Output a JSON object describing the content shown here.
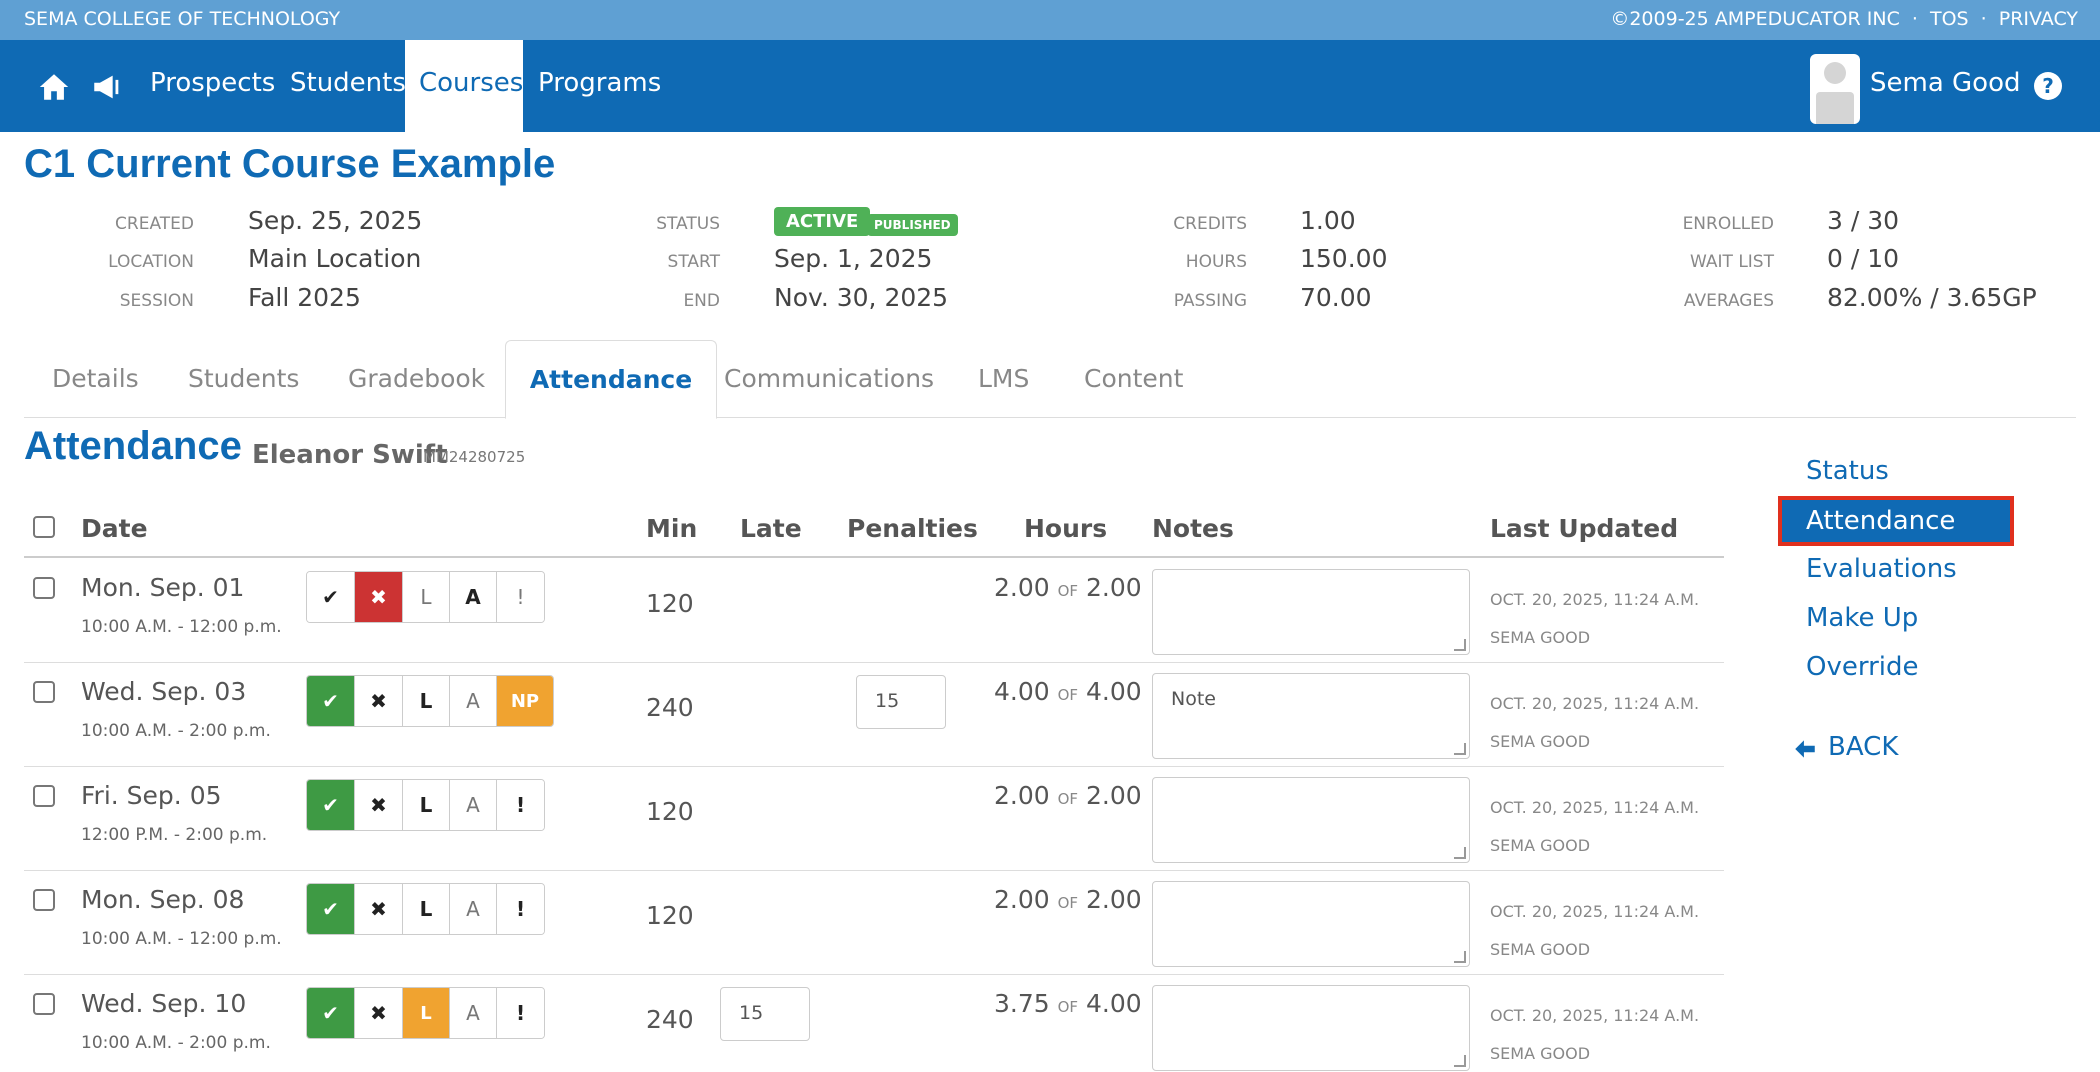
{
  "topstrip": {
    "college": "SEMA COLLEGE OF TECHNOLOGY",
    "copyright": "©2009-25 AMPEDUCATOR INC",
    "sep": "·",
    "tos": "TOS",
    "privacy": "PRIVACY"
  },
  "nav": {
    "icons": [
      "home-icon",
      "megaphone-icon"
    ],
    "items": [
      "Prospects",
      "Students",
      "Courses",
      "Programs"
    ],
    "active": "Courses",
    "user": "Sema Good",
    "help": "?"
  },
  "course": {
    "title": "C1 Current Course Example",
    "created_label": "CREATED",
    "created": "Sep. 25, 2025",
    "location_label": "LOCATION",
    "location": "Main Location",
    "session_label": "SESSION",
    "session": "Fall 2025",
    "status_label": "STATUS",
    "status": "ACTIVE",
    "published": "PUBLISHED",
    "start_label": "START",
    "start": "Sep. 1, 2025",
    "end_label": "END",
    "end": "Nov. 30, 2025",
    "credits_label": "CREDITS",
    "credits": "1.00",
    "hours_label": "HOURS",
    "hours": "150.00",
    "passing_label": "PASSING",
    "passing": "70.00",
    "enrolled_label": "ENROLLED",
    "enrolled": "3 / 30",
    "waitlist_label": "WAIT LIST",
    "waitlist": "0 / 10",
    "averages_label": "AVERAGES",
    "averages": "82.00% / 3.65GP"
  },
  "tabs": [
    "Details",
    "Students",
    "Gradebook",
    "Attendance",
    "Communications",
    "LMS",
    "Content"
  ],
  "attendance": {
    "title": "Attendance",
    "student": "Eleanor Swift",
    "student_id": "MM24280725",
    "columns": {
      "date": "Date",
      "min": "Min",
      "late": "Late",
      "penalties": "Penalties",
      "hours": "Hours",
      "notes": "Notes",
      "updated": "Last Updated"
    },
    "of": "OF",
    "rows": [
      {
        "date": "Mon. Sep. 01",
        "time": "10:00 A.M. - 12:00 p.m.",
        "min": "120",
        "late": "",
        "penalty": "",
        "hours": "2.00",
        "of_hours": "2.00",
        "note": "",
        "updated": "OCT. 20, 2025, 11:24 A.M.",
        "by": "SEMA GOOD",
        "selected": "absent",
        "last_btn": "!"
      },
      {
        "date": "Wed. Sep. 03",
        "time": "10:00 A.M. - 2:00 p.m.",
        "min": "240",
        "late": "",
        "penalty": "15",
        "hours": "4.00",
        "of_hours": "4.00",
        "note": "Note",
        "updated": "OCT. 20, 2025, 11:24 A.M.",
        "by": "SEMA GOOD",
        "selected": "present",
        "last_btn": "NP"
      },
      {
        "date": "Fri. Sep. 05",
        "time": "12:00 P.M. - 2:00 p.m.",
        "min": "120",
        "late": "",
        "penalty": "",
        "hours": "2.00",
        "of_hours": "2.00",
        "note": "",
        "updated": "OCT. 20, 2025, 11:24 A.M.",
        "by": "SEMA GOOD",
        "selected": "present",
        "last_btn": "!"
      },
      {
        "date": "Mon. Sep. 08",
        "time": "10:00 A.M. - 12:00 p.m.",
        "min": "120",
        "late": "",
        "penalty": "",
        "hours": "2.00",
        "of_hours": "2.00",
        "note": "",
        "updated": "OCT. 20, 2025, 11:24 A.M.",
        "by": "SEMA GOOD",
        "selected": "present",
        "last_btn": "!"
      },
      {
        "date": "Wed. Sep. 10",
        "time": "10:00 A.M. - 2:00 p.m.",
        "min": "240",
        "late": "15",
        "penalty": "",
        "hours": "3.75",
        "of_hours": "4.00",
        "note": "",
        "updated": "OCT. 20, 2025, 11:24 A.M.",
        "by": "SEMA GOOD",
        "selected": "present-late",
        "last_btn": "!"
      }
    ],
    "buttons": {
      "check": "✔",
      "cross": "✖",
      "late": "L",
      "absent": "A"
    }
  },
  "side": {
    "items": [
      "Status",
      "Attendance",
      "Evaluations",
      "Make Up",
      "Override"
    ],
    "active": "Attendance",
    "back": "BACK"
  },
  "colors": {
    "brand": "#0f6ab4",
    "topstrip": "#5fa0d3",
    "green": "#3e9a44",
    "red": "#cc3333",
    "orange": "#f0a330",
    "highlight_border": "#e0301e"
  }
}
